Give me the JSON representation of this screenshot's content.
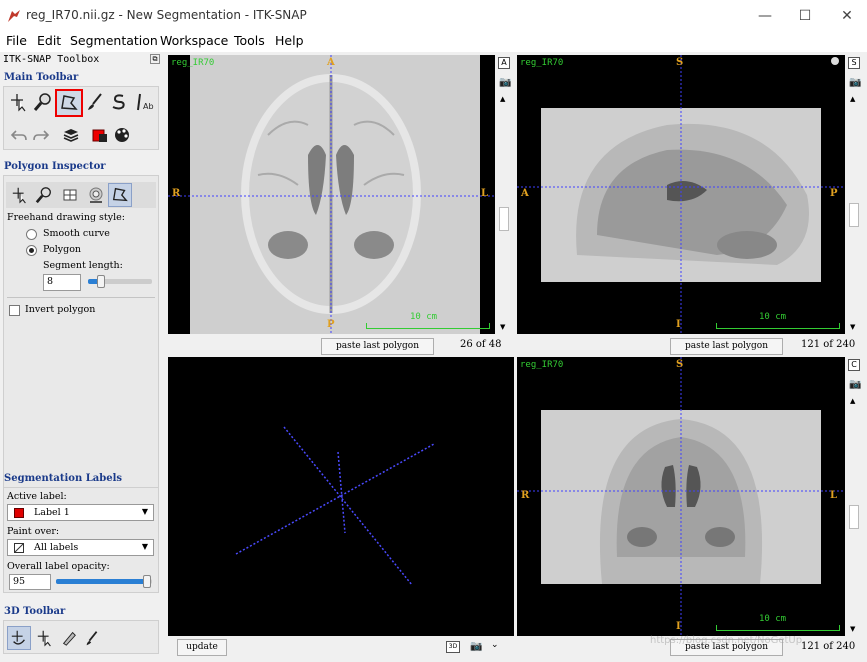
{
  "window": {
    "title": "reg_IR70.nii.gz - New Segmentation - ITK-SNAP",
    "minimize": "—",
    "maximize": "☐",
    "close": "✕"
  },
  "menu": [
    "File",
    "Edit",
    "Segmentation",
    "Workspace",
    "Tools",
    "Help"
  ],
  "toolbox": {
    "title": "ITK-SNAP Toolbox",
    "main_toolbar": "Main Toolbar",
    "polygon_inspector": "Polygon Inspector",
    "freehand_style": "Freehand drawing style:",
    "smooth_curve": "Smooth curve",
    "polygon": "Polygon",
    "segment_length_label": "Segment length:",
    "segment_length": "8",
    "segment_fraction": 0.2,
    "invert_polygon": "Invert polygon",
    "seg_labels": "Segmentation Labels",
    "active_label_title": "Active label:",
    "active_label": "Label 1",
    "active_label_color": "#e00000",
    "paint_over_title": "Paint over:",
    "paint_over": "All labels",
    "opacity_title": "Overall label opacity:",
    "opacity": "95",
    "opacity_fraction": 0.95,
    "toolbar3d": "3D Toolbar"
  },
  "views": {
    "axial": {
      "name": "reg_IR70",
      "top": "A",
      "bottom": "P",
      "left": "R",
      "right": "L",
      "scale": "10 cm",
      "paste": "paste last polygon",
      "slice": "26 of 48"
    },
    "sagittal": {
      "name": "reg_IR70",
      "top": "S",
      "bottom": "I",
      "left": "A",
      "right": "P",
      "scale": "10 cm",
      "paste": "paste last polygon",
      "slice": "121 of 240"
    },
    "coronal": {
      "name": "reg_IR70",
      "top": "S",
      "bottom": "I",
      "left": "R",
      "right": "L",
      "scale": "10 cm",
      "paste": "paste last polygon",
      "slice": "121 of 240"
    },
    "three_d": {
      "update": "update",
      "btn3d": "3D"
    }
  },
  "watermark": "https://blog.csdn.net/NoGetUp"
}
